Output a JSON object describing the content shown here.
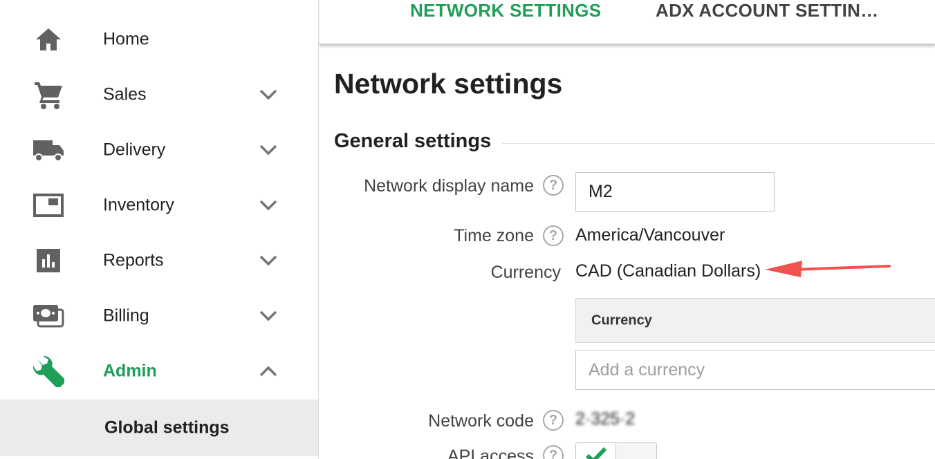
{
  "sidebar": {
    "items": [
      {
        "label": "Home",
        "icon": "home-icon"
      },
      {
        "label": "Sales",
        "icon": "cart-icon"
      },
      {
        "label": "Delivery",
        "icon": "truck-icon"
      },
      {
        "label": "Inventory",
        "icon": "inventory-icon"
      },
      {
        "label": "Reports",
        "icon": "bar-chart-icon"
      },
      {
        "label": "Billing",
        "icon": "money-icon"
      },
      {
        "label": "Admin",
        "icon": "wrench-icon"
      }
    ],
    "sub_items": [
      {
        "label": "Global settings"
      }
    ]
  },
  "tabs": [
    {
      "label": "NETWORK SETTINGS",
      "active": true
    },
    {
      "label": "ADX ACCOUNT SETTIN…",
      "active": false
    }
  ],
  "main": {
    "title": "Network settings",
    "section": "General settings",
    "fields": {
      "network_display_name": {
        "label": "Network display name",
        "value": "M2"
      },
      "time_zone": {
        "label": "Time zone",
        "value": "America/Vancouver"
      },
      "currency": {
        "label": "Currency",
        "value": "CAD (Canadian Dollars)"
      },
      "currency_table": {
        "header": "Currency",
        "placeholder": "Add a currency"
      },
      "network_code": {
        "label": "Network code",
        "value": "2·325·2"
      },
      "api_access": {
        "label": "API access"
      }
    },
    "help_symbol": "?"
  },
  "colors": {
    "accent": "#1e9e57",
    "icon_gray": "#616161",
    "annotation_arrow": "#ef5350"
  }
}
